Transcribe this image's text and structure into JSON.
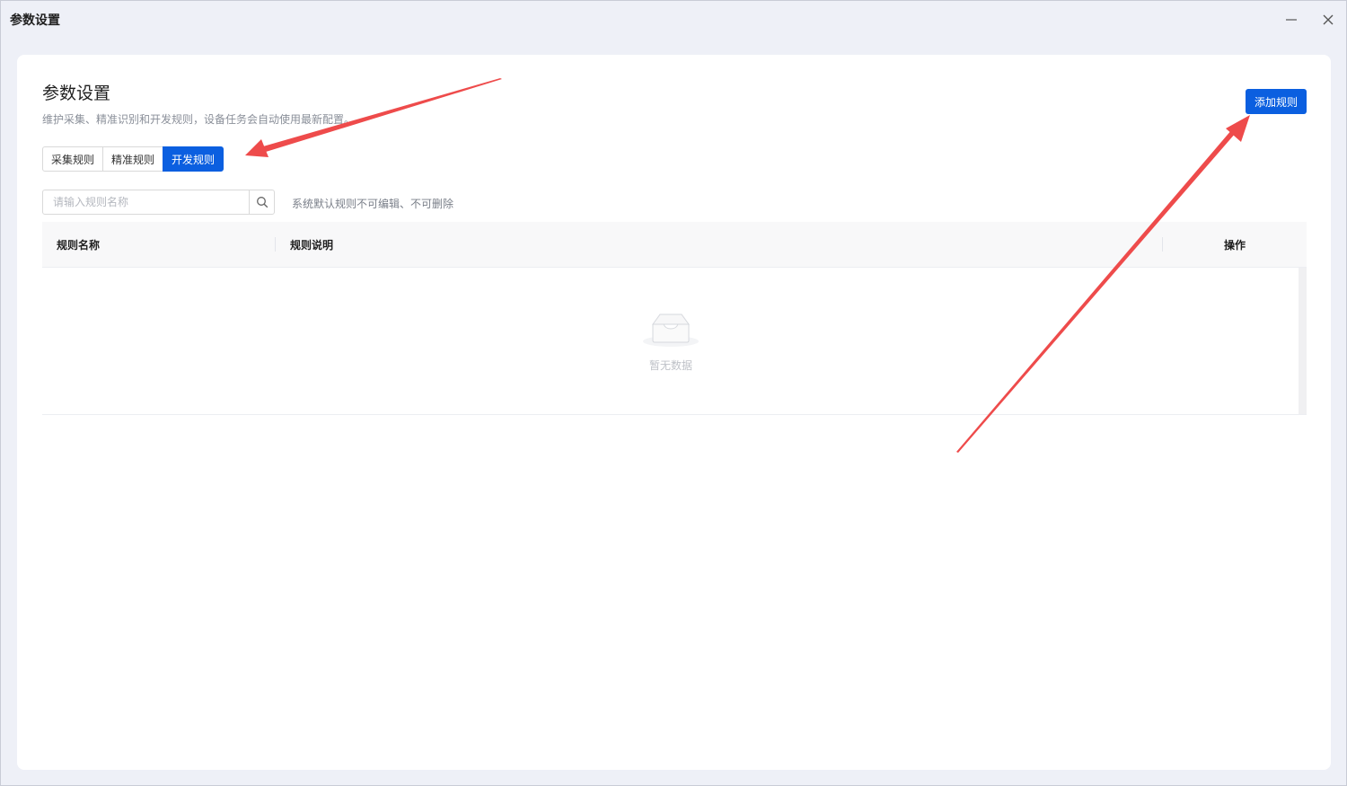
{
  "window": {
    "title": "参数设置"
  },
  "header": {
    "title": "参数设置",
    "description": "维护采集、精准识别和开发规则，设备任务会自动使用最新配置。",
    "add_button": "添加规则"
  },
  "tabs": [
    {
      "label": "采集规则",
      "active": false
    },
    {
      "label": "精准规则",
      "active": false
    },
    {
      "label": "开发规则",
      "active": true
    }
  ],
  "search": {
    "placeholder": "请输入规则名称",
    "value": "",
    "icon": "search-icon"
  },
  "hint": "系统默认规则不可编辑、不可删除",
  "table": {
    "columns": [
      "规则名称",
      "规则说明",
      "操作"
    ],
    "rows": [],
    "empty_text": "暂无数据"
  },
  "colors": {
    "accent": "#0b5fe0",
    "annotation_arrow": "#ee4b4b"
  }
}
